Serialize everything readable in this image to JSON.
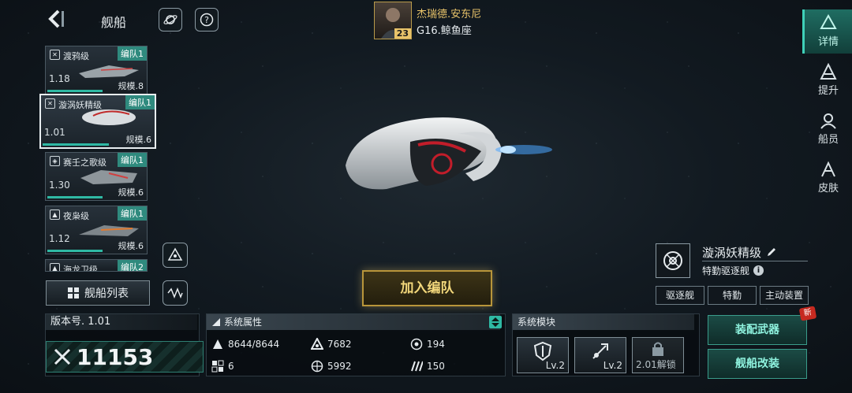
{
  "header": {
    "title": "舰船",
    "back_label": "back",
    "commander_name": "杰瑞德.安东尼",
    "commander_location": "G16.鲸鱼座",
    "commander_level": "23"
  },
  "ship_list": [
    {
      "name": "渡鸦级",
      "fleet": "编队1",
      "version": "1.18",
      "scale": "规模.8",
      "selected": false
    },
    {
      "name": "漩涡妖精级",
      "fleet": "编队1",
      "version": "1.01",
      "scale": "规模.6",
      "selected": true
    },
    {
      "name": "赛壬之歌级",
      "fleet": "编队1",
      "version": "1.30",
      "scale": "规模.6",
      "selected": false
    },
    {
      "name": "夜枭级",
      "fleet": "编队1",
      "version": "1.12",
      "scale": "规模.6",
      "selected": false
    },
    {
      "name": "海龙卫级",
      "fleet": "编队2",
      "version": "",
      "scale": "",
      "selected": false
    }
  ],
  "ship_list_button": "舰船列表",
  "join_fleet_button": "加入编队",
  "right_nav": [
    {
      "label": "详情",
      "icon": "detail-icon",
      "active": true
    },
    {
      "label": "提升",
      "icon": "upgrade-icon",
      "active": false
    },
    {
      "label": "船员",
      "icon": "crew-icon",
      "active": false
    },
    {
      "label": "皮肤",
      "icon": "skin-icon",
      "active": false
    }
  ],
  "ship_info": {
    "name": "漩涡妖精级",
    "class": "特勤驱逐舰",
    "tags": [
      "驱逐舰",
      "特勤",
      "主动装置"
    ]
  },
  "version_panel": {
    "label": "版本号. 1.01",
    "power": "11153"
  },
  "attributes": {
    "header": "系统属性",
    "stats": [
      {
        "icon": "hull-icon",
        "value": "8644/8644"
      },
      {
        "icon": "armor-icon",
        "value": "7682"
      },
      {
        "icon": "shield-icon",
        "value": "194"
      },
      {
        "icon": "grid-icon",
        "value": "6"
      },
      {
        "icon": "target-icon",
        "value": "5992"
      },
      {
        "icon": "speed-icon",
        "value": "150"
      }
    ]
  },
  "modules": {
    "header": "系统模块",
    "items": [
      {
        "icon": "defense-module-icon",
        "level": "Lv.2"
      },
      {
        "icon": "attack-module-icon",
        "level": "Lv.2"
      },
      {
        "icon": "lock-icon",
        "level": "2.01解锁"
      }
    ]
  },
  "actions": {
    "equip_weapon": "装配武器",
    "new_badge": "新",
    "ship_modify": "舰船改装"
  },
  "colors": {
    "accent": "#2fb9a4",
    "gold": "#e9c46a",
    "fleet_tag": "#2f8a7e"
  }
}
